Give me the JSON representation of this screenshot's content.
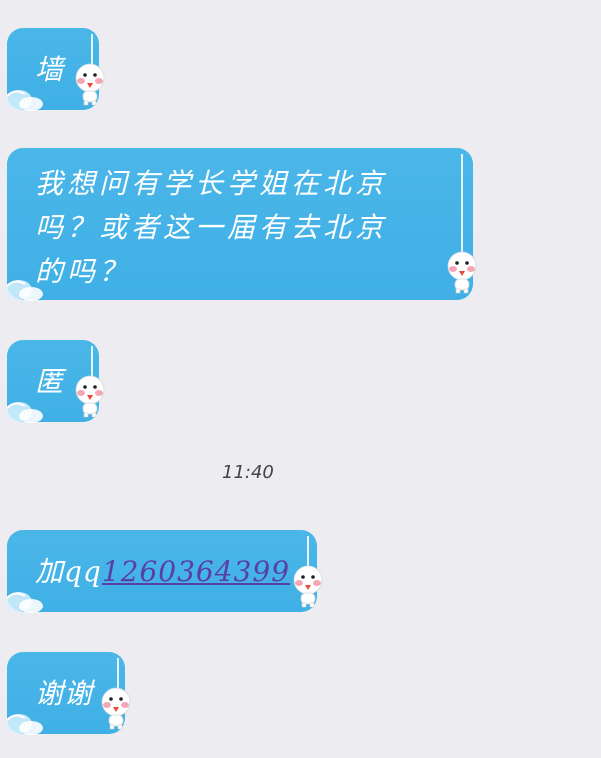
{
  "messages": [
    {
      "text": "墙"
    },
    {
      "text": "我想问有学长学姐在北京吗？或者这一届有去北京的吗？"
    },
    {
      "text": "匿"
    },
    {
      "prefix": "加qq",
      "link": "1260364399"
    },
    {
      "text": "谢谢"
    }
  ],
  "timestamp": "11:40",
  "colors": {
    "bubble": "#45b3e7",
    "background": "#ededf1",
    "link": "#5a3ea6"
  },
  "icons": {
    "decoration": "snow-doll-icon",
    "cloud": "cloud-icon"
  }
}
